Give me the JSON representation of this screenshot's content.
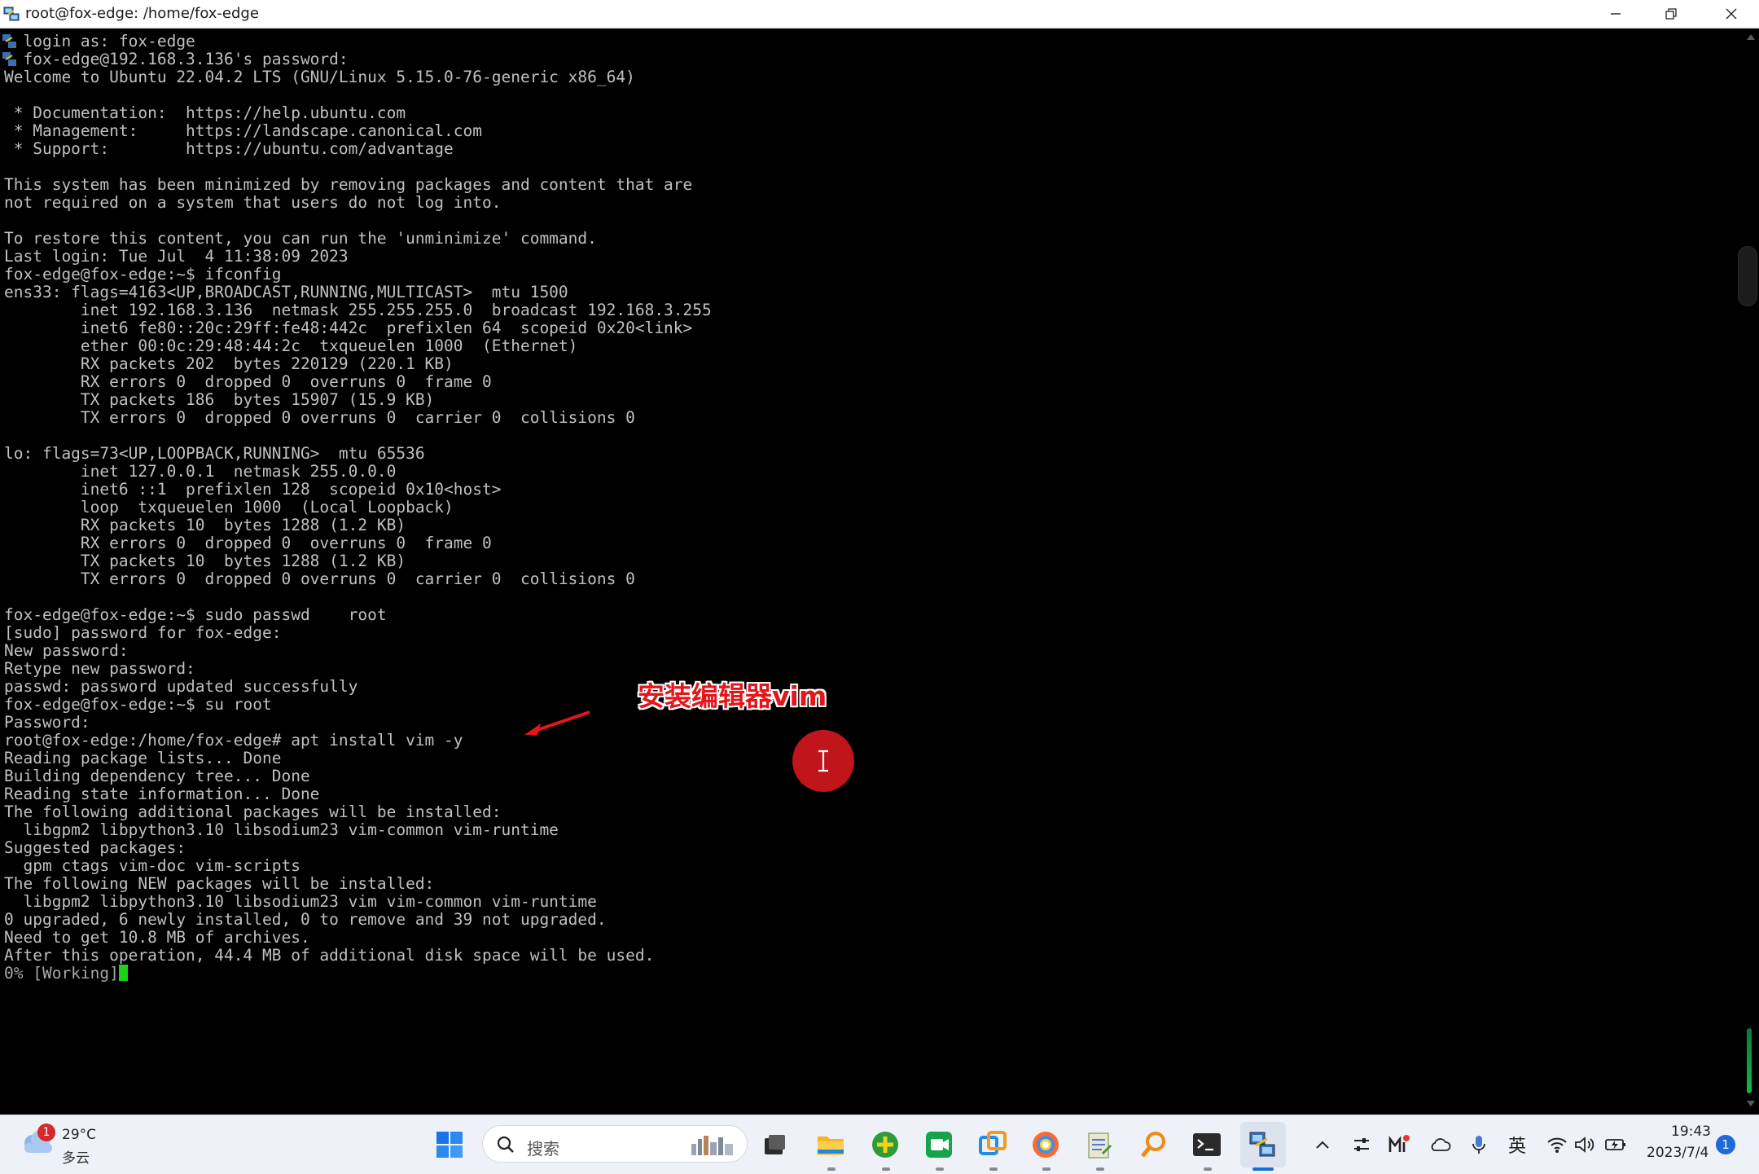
{
  "window": {
    "title": "root@fox-edge: /home/fox-edge"
  },
  "terminal": {
    "lines": [
      "  login as: fox-edge",
      "  fox-edge@192.168.3.136's password:",
      "Welcome to Ubuntu 22.04.2 LTS (GNU/Linux 5.15.0-76-generic x86_64)",
      "",
      " * Documentation:  https://help.ubuntu.com",
      " * Management:     https://landscape.canonical.com",
      " * Support:        https://ubuntu.com/advantage",
      "",
      "This system has been minimized by removing packages and content that are",
      "not required on a system that users do not log into.",
      "",
      "To restore this content, you can run the 'unminimize' command.",
      "Last login: Tue Jul  4 11:38:09 2023",
      "fox-edge@fox-edge:~$ ifconfig",
      "ens33: flags=4163<UP,BROADCAST,RUNNING,MULTICAST>  mtu 1500",
      "        inet 192.168.3.136  netmask 255.255.255.0  broadcast 192.168.3.255",
      "        inet6 fe80::20c:29ff:fe48:442c  prefixlen 64  scopeid 0x20<link>",
      "        ether 00:0c:29:48:44:2c  txqueuelen 1000  (Ethernet)",
      "        RX packets 202  bytes 220129 (220.1 KB)",
      "        RX errors 0  dropped 0  overruns 0  frame 0",
      "        TX packets 186  bytes 15907 (15.9 KB)",
      "        TX errors 0  dropped 0 overruns 0  carrier 0  collisions 0",
      "",
      "lo: flags=73<UP,LOOPBACK,RUNNING>  mtu 65536",
      "        inet 127.0.0.1  netmask 255.0.0.0",
      "        inet6 ::1  prefixlen 128  scopeid 0x10<host>",
      "        loop  txqueuelen 1000  (Local Loopback)",
      "        RX packets 10  bytes 1288 (1.2 KB)",
      "        RX errors 0  dropped 0  overruns 0  frame 0",
      "        TX packets 10  bytes 1288 (1.2 KB)",
      "        TX errors 0  dropped 0 overruns 0  carrier 0  collisions 0",
      "",
      "fox-edge@fox-edge:~$ sudo passwd    root",
      "[sudo] password for fox-edge:",
      "New password:",
      "Retype new password:",
      "passwd: password updated successfully",
      "fox-edge@fox-edge:~$ su root",
      "Password:",
      "root@fox-edge:/home/fox-edge# apt install vim -y",
      "Reading package lists... Done",
      "Building dependency tree... Done",
      "Reading state information... Done",
      "The following additional packages will be installed:",
      "  libgpm2 libpython3.10 libsodium23 vim-common vim-runtime",
      "Suggested packages:",
      "  gpm ctags vim-doc vim-scripts",
      "The following NEW packages will be installed:",
      "  libgpm2 libpython3.10 libsodium23 vim vim-common vim-runtime",
      "0 upgraded, 6 newly installed, 0 to remove and 39 not upgraded.",
      "Need to get 10.8 MB of archives.",
      "After this operation, 44.4 MB of additional disk space will be used.",
      "0% [Working]"
    ],
    "colors": {
      "text": "#c0c0c0",
      "background": "#000000",
      "cursor": "#19d219"
    }
  },
  "annotation": {
    "text": "安装编辑器vim",
    "color": "#e3161b"
  },
  "taskbar": {
    "weather": {
      "temperature": "29°C",
      "description": "多云",
      "badge": "1"
    },
    "search_placeholder": "搜索",
    "apps": [
      {
        "name": "task-view-icon"
      },
      {
        "name": "file-explorer-icon"
      },
      {
        "name": "green-plus-app-icon"
      },
      {
        "name": "video-meeting-icon"
      },
      {
        "name": "remote-app-icon"
      },
      {
        "name": "browser-icon"
      },
      {
        "name": "notepad-icon"
      },
      {
        "name": "search-tool-icon"
      },
      {
        "name": "terminal-icon"
      },
      {
        "name": "putty-icon"
      }
    ],
    "tray": {
      "ime_label": "英"
    },
    "clock": {
      "time": "19:43",
      "date": "2023/7/4"
    },
    "notification_count": "1"
  }
}
